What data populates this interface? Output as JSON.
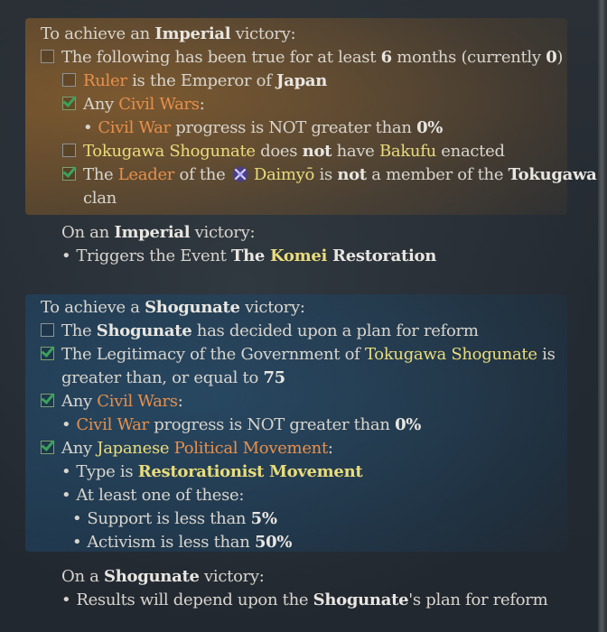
{
  "imperial": {
    "heading_pre": "To achieve an ",
    "heading_bold": "Imperial",
    "heading_post": " victory:",
    "cond1_pre": "The following has been true for at least ",
    "cond1_months": "6",
    "cond1_mid": " months (currently ",
    "cond1_current": "0",
    "cond1_post": ")",
    "ruler_a": "Ruler",
    "ruler_b": " is the Emperor of ",
    "ruler_c": "Japan",
    "civil_a": "Any ",
    "civil_b": "Civil Wars",
    "civil_c": ":",
    "cw_a": "Civil War",
    "cw_b": " progress is NOT greater than ",
    "cw_c": "0%",
    "toku_a": "Tokugawa Shogunate",
    "toku_b": " does ",
    "toku_c": "not",
    "toku_d": " have ",
    "toku_e": "Bakufu",
    "toku_f": " enacted",
    "leader_a": "The ",
    "leader_b": "Leader",
    "leader_c": " of the ",
    "leader_icon": "daimyo-icon",
    "leader_d": "Daimyō",
    "leader_e": " is ",
    "leader_f": "not",
    "leader_g": " a member of the ",
    "leader_h": "Tokugawa",
    "leader_i": "clan",
    "on_pre": "On an ",
    "on_bold": "Imperial",
    "on_post": " victory:",
    "trig_a": "Triggers the Event ",
    "trig_b": "The ",
    "trig_c": "Komei",
    "trig_d": " Restoration"
  },
  "shogunate": {
    "heading_pre": "To achieve a ",
    "heading_bold": "Shogunate",
    "heading_post": " victory:",
    "plan_a": "The ",
    "plan_b": "Shogunate",
    "plan_c": " has decided upon a plan for reform",
    "legit_a": "The Legitimacy of the Government of ",
    "legit_b": "Tokugawa Shogunate",
    "legit_c": " is",
    "legit_d": "greater than, or equal to ",
    "legit_e": "75",
    "civil_a": "Any ",
    "civil_b": "Civil Wars",
    "civil_c": ":",
    "cw_a": "Civil War",
    "cw_b": " progress is NOT greater than ",
    "cw_c": "0%",
    "pm_a": "Any ",
    "pm_b": "Japanese",
    "pm_c": " ",
    "pm_d": "Political Movement",
    "pm_e": ":",
    "type_a": "Type is ",
    "type_b": "Restorationist Movement",
    "atleast": "At least one of these:",
    "sup_a": "Support is less than ",
    "sup_b": "5%",
    "act_a": "Activism is less than ",
    "act_b": "50%",
    "on_pre": "On a ",
    "on_bold": "Shogunate",
    "on_post": " victory:",
    "res_a": "Results will depend upon the ",
    "res_b": "Shogunate",
    "res_c": "'s plan for reform"
  },
  "checks": {
    "imp_following": false,
    "imp_ruler": false,
    "imp_civil": true,
    "imp_toku": false,
    "imp_leader": true,
    "sho_plan": false,
    "sho_legit": true,
    "sho_civil": true,
    "sho_pm": true
  },
  "colors": {
    "highlight_orange": "#e8904a",
    "highlight_yellow": "#eadc7b",
    "check_green": "#3aa35a"
  }
}
